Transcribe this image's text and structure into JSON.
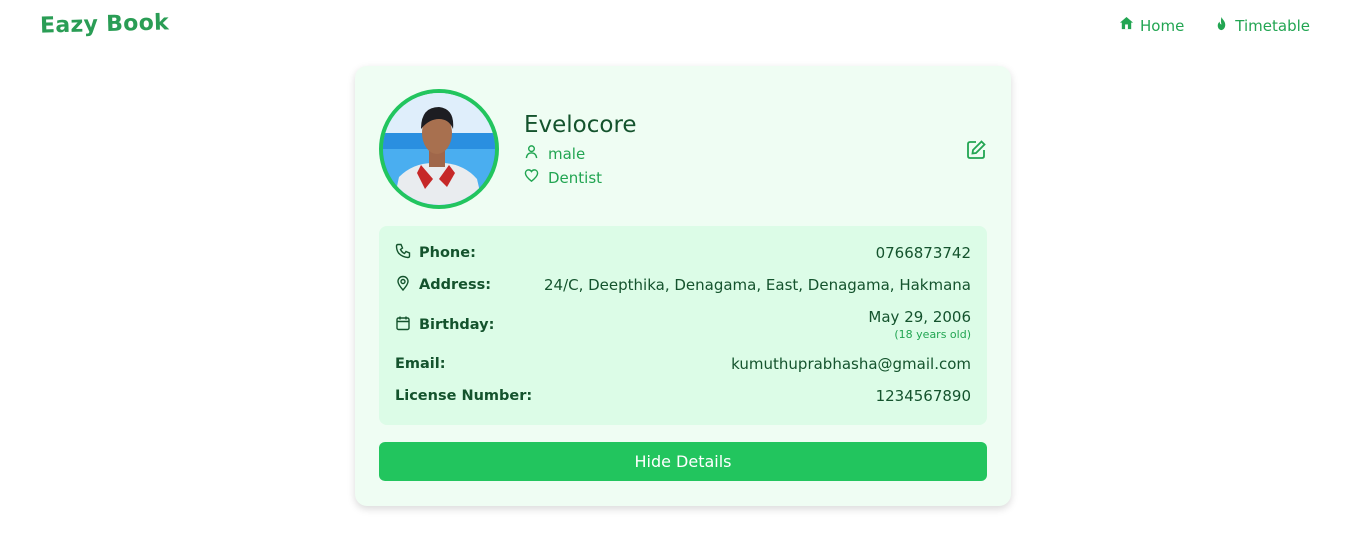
{
  "header": {
    "logo": "Eazy Book",
    "nav": [
      {
        "label": "Home",
        "icon": "home-icon"
      },
      {
        "label": "Timetable",
        "icon": "flame-icon"
      }
    ]
  },
  "profile": {
    "name": "Evelocore",
    "gender": "male",
    "profession": "Dentist",
    "avatar_icon": "profile-photo",
    "edit_icon": "edit-icon"
  },
  "details": {
    "phone": {
      "label": "Phone:",
      "value": "0766873742"
    },
    "address": {
      "label": "Address:",
      "value": "24/C, Deepthika, Denagama, East, Denagama, Hakmana"
    },
    "birthday": {
      "label": "Birthday:",
      "value": "May 29, 2006",
      "age": "(18 years old)"
    },
    "email": {
      "label": "Email:",
      "value": "kumuthuprabhasha@gmail.com"
    },
    "license": {
      "label": "License Number:",
      "value": "1234567890"
    }
  },
  "actions": {
    "toggle_label": "Hide Details"
  },
  "colors": {
    "accent": "#22c55e",
    "dark_text": "#14532d",
    "card_bg": "#effdf3",
    "panel_bg": "#dcfce7"
  }
}
